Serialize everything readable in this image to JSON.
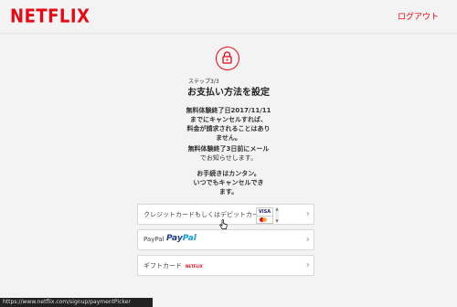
{
  "header": {
    "logo": "NETFLIX",
    "logout_label": "ログアウト"
  },
  "main": {
    "step_label": "ステップ3/3",
    "title": "お支払い方法を設定",
    "trial_end_lines": [
      "無料体験終了日2017/11/11",
      "までにキャンセルすれば、",
      "料金が請求されることはあり",
      "ません。"
    ],
    "reminder_lines": [
      "無料体験終了3日前にメール",
      "でお知らせします。"
    ],
    "easy_lines": [
      "お手続きはカンタン。",
      "いつでもキャンセルでき",
      "ます。"
    ]
  },
  "payment_options": [
    {
      "label": "クレジットカードもしくはデビットカード",
      "icon": "card-logos"
    },
    {
      "label": "PayPal",
      "brand_part1": "Pay",
      "brand_part2": "Pal",
      "icon": "paypal-logo"
    },
    {
      "label": "ギフトカード",
      "brand": "NETFLIX",
      "icon": "netflix-logo"
    }
  ],
  "card_logos": {
    "visa": "VISA"
  },
  "status_bar": {
    "url": "https://www.netflix.com/signup/paymentPicker"
  },
  "colors": {
    "brand_red": "#e50914",
    "paypal_dark": "#253b80",
    "paypal_light": "#179bd7"
  }
}
